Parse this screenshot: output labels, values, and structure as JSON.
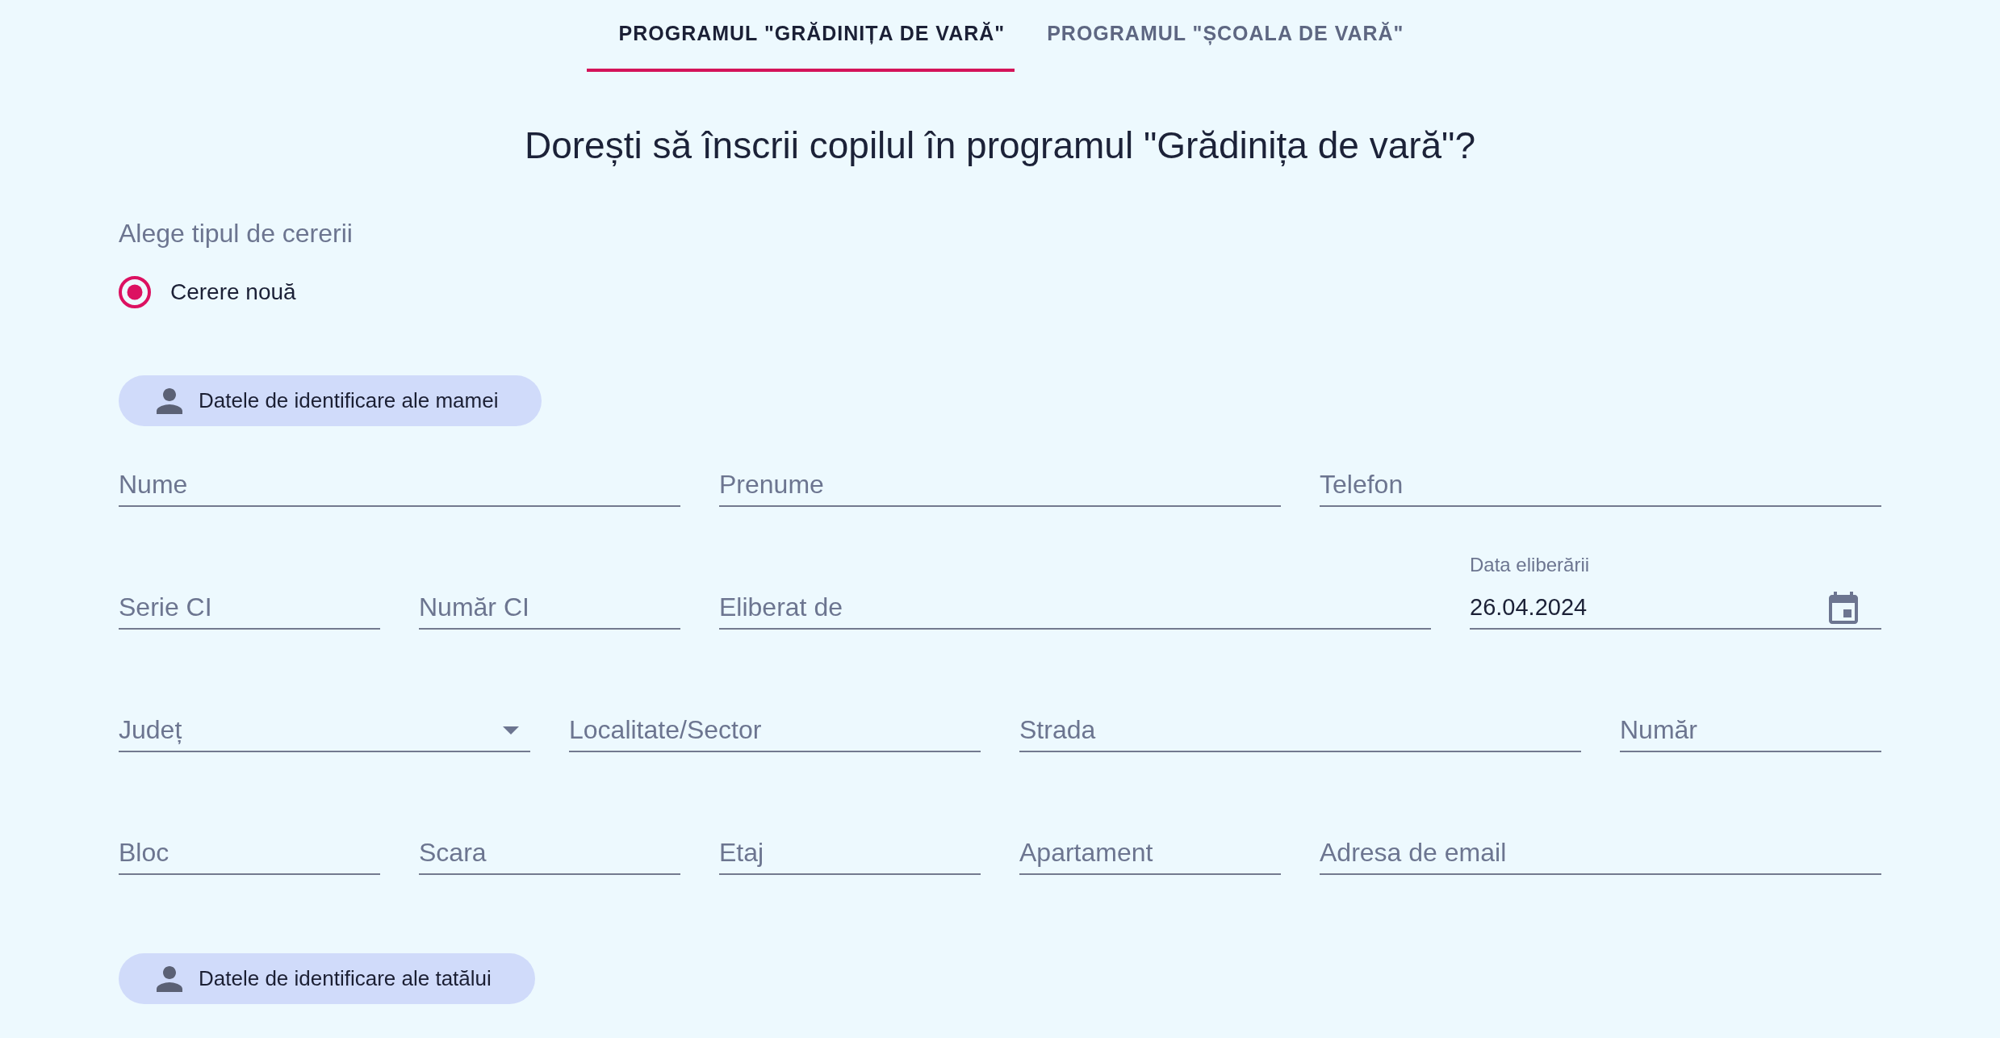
{
  "tabs": [
    {
      "label": "PROGRAMUL \"GRĂDINIȚA DE VARĂ\"",
      "selected": true
    },
    {
      "label": "PROGRAMUL \"ȘCOALA DE VARĂ\"",
      "selected": false
    }
  ],
  "heading": "Dorești să înscrii copilul în programul \"Grădinița de vară\"?",
  "request_type": {
    "label": "Alege tipul de cererii",
    "options": [
      {
        "label": "Cerere nouă",
        "selected": true
      }
    ]
  },
  "sections": [
    {
      "button": "Datele de identificare ale mamei",
      "rows": [
        {
          "fields": [
            {
              "kind": "text",
              "placeholder": "Nume"
            },
            {
              "kind": "text",
              "placeholder": "Prenume"
            },
            {
              "kind": "text",
              "placeholder": "Telefon"
            }
          ]
        },
        {
          "fields": [
            {
              "kind": "text",
              "placeholder": "Serie CI"
            },
            {
              "kind": "text",
              "placeholder": "Număr CI"
            },
            {
              "kind": "text",
              "placeholder": "Eliberat de"
            },
            {
              "kind": "date",
              "label": "Data eliberării",
              "value": "26.04.2024"
            }
          ]
        },
        {
          "fields": [
            {
              "kind": "select",
              "placeholder": "Județ"
            },
            {
              "kind": "text",
              "placeholder": "Localitate/Sector"
            },
            {
              "kind": "text",
              "placeholder": "Strada"
            },
            {
              "kind": "text",
              "placeholder": "Număr"
            }
          ]
        },
        {
          "fields": [
            {
              "kind": "text",
              "placeholder": "Bloc"
            },
            {
              "kind": "text",
              "placeholder": "Scara"
            },
            {
              "kind": "text",
              "placeholder": "Etaj"
            },
            {
              "kind": "text",
              "placeholder": "Apartament"
            },
            {
              "kind": "text",
              "placeholder": "Adresa de email"
            }
          ]
        }
      ]
    },
    {
      "button": "Datele de identificare ale tatălui"
    }
  ]
}
